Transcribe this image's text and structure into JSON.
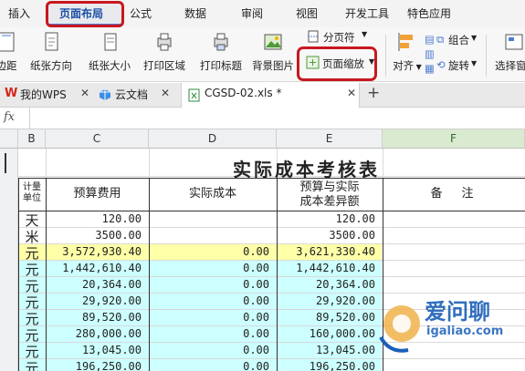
{
  "ribbon": {
    "tabs": [
      "插入",
      "页面布局",
      "公式",
      "数据",
      "审阅",
      "视图",
      "开发工具",
      "特色应用"
    ],
    "active_tab": "页面布局",
    "highlight_color": "#c8171f"
  },
  "toolbar": {
    "buttons": [
      "边距",
      "纸张方向",
      "纸张大小",
      "打印区域",
      "打印标题",
      "背景图片",
      "对齐",
      "选择窗"
    ],
    "fen_ye_fu": "分页符",
    "page_zoom": "页面缩放",
    "group": "组合",
    "rotate": "旋转",
    "align_icons": [
      "align-top-icon",
      "align-middle-icon",
      "align-bottom-icon"
    ]
  },
  "doc_tabs": [
    {
      "label": "我的WPS",
      "icon": "wps-logo-icon"
    },
    {
      "label": "云文档",
      "icon": "cloud-doc-icon"
    },
    {
      "label": "CGSD-02.xls *",
      "icon": "excel-file-icon"
    }
  ],
  "formula_bar": {
    "fx": "fx",
    "value": ""
  },
  "columns": [
    "B",
    "C",
    "D",
    "E",
    "F"
  ],
  "selected_column": "F",
  "sheet": {
    "title": "实际成本考核表",
    "headers": {
      "unit_line1": "计量",
      "unit_line2": "单位",
      "budget": "预算费用",
      "actual": "实际成本",
      "diff_line1": "预算与实际",
      "diff_line2": "成本差异额",
      "note": "备　注"
    },
    "rows": [
      {
        "unit": "天",
        "budget": "120.00",
        "actual": "",
        "diff": "120.00",
        "fill": "none"
      },
      {
        "unit": "米",
        "budget": "3500.00",
        "actual": "",
        "diff": "3500.00",
        "fill": "none"
      },
      {
        "unit": "元",
        "budget": "3,572,930.40",
        "actual": "0.00",
        "diff": "3,621,330.40",
        "fill": "yellow"
      },
      {
        "unit": "元",
        "budget": "1,442,610.40",
        "actual": "0.00",
        "diff": "1,442,610.40",
        "fill": "cyan"
      },
      {
        "unit": "元",
        "budget": "20,364.00",
        "actual": "0.00",
        "diff": "20,364.00",
        "fill": "cyan"
      },
      {
        "unit": "元",
        "budget": "29,920.00",
        "actual": "0.00",
        "diff": "29,920.00",
        "fill": "cyan"
      },
      {
        "unit": "元",
        "budget": "89,520.00",
        "actual": "0.00",
        "diff": "89,520.00",
        "fill": "cyan"
      },
      {
        "unit": "元",
        "budget": "280,000.00",
        "actual": "0.00",
        "diff": "160,000.00",
        "fill": "cyan"
      },
      {
        "unit": "元",
        "budget": "13,045.00",
        "actual": "0.00",
        "diff": "13,045.00",
        "fill": "cyan"
      },
      {
        "unit": "元",
        "budget": "196,250.00",
        "actual": "0.00",
        "diff": "196,250.00",
        "fill": "cyan"
      }
    ]
  },
  "watermark": {
    "brand": "爱问聊",
    "url": "igaliao.com"
  },
  "colors": {
    "yellow_row": "#ffffa8",
    "cyan_row": "#ccfffe",
    "accent": "#4a7bd0"
  }
}
